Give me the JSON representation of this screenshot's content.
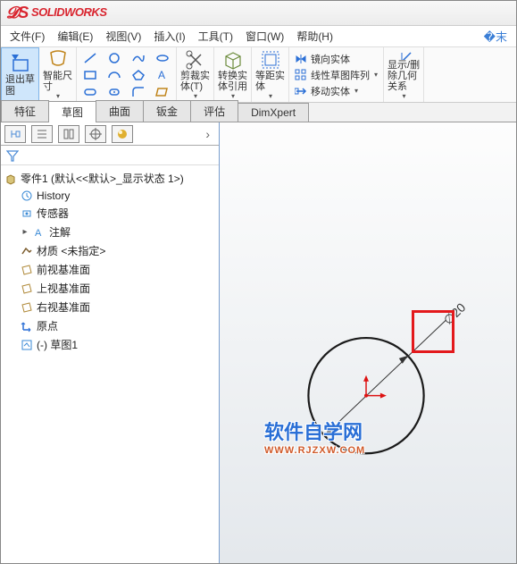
{
  "app": {
    "name": "SOLIDWORKS"
  },
  "menu": {
    "file": "文件(F)",
    "edit": "编辑(E)",
    "view": "视图(V)",
    "insert": "插入(I)",
    "tools": "工具(T)",
    "window": "窗口(W)",
    "help": "帮助(H)"
  },
  "ribbon": {
    "exit_sketch": "退出草\n图",
    "smart_dim": "智能尺\n寸",
    "trim": "剪裁实\n体(T)",
    "convert": "转换实\n体引用",
    "offset": "等距实\n体",
    "mirror": "镜向实体",
    "linear_pattern": "线性草图阵列",
    "move": "移动实体",
    "show_rel": "显示/删\n除几何\n关系"
  },
  "tabs": {
    "feature": "特征",
    "sketch": "草图",
    "surface": "曲面",
    "sheetmetal": "钣金",
    "evaluate": "评估",
    "dimxpert": "DimXpert"
  },
  "tree": {
    "root": "零件1  (默认<<默认>_显示状态 1>)",
    "history": "History",
    "sensors": "传感器",
    "annotations": "注解",
    "material": "材质 <未指定>",
    "front": "前视基准面",
    "top": "上视基准面",
    "right": "右视基准面",
    "origin": "原点",
    "sketch1": "(-) 草图1"
  },
  "canvas": {
    "dim_label": "∅20"
  },
  "watermark": {
    "title": "软件自学网",
    "url": "WWW.RJZXW.COM"
  },
  "chart_data": {
    "type": "diagram",
    "shapes": [
      {
        "kind": "circle",
        "diameter": 20,
        "dimension_label": "∅20"
      }
    ],
    "origin_marker": true
  }
}
